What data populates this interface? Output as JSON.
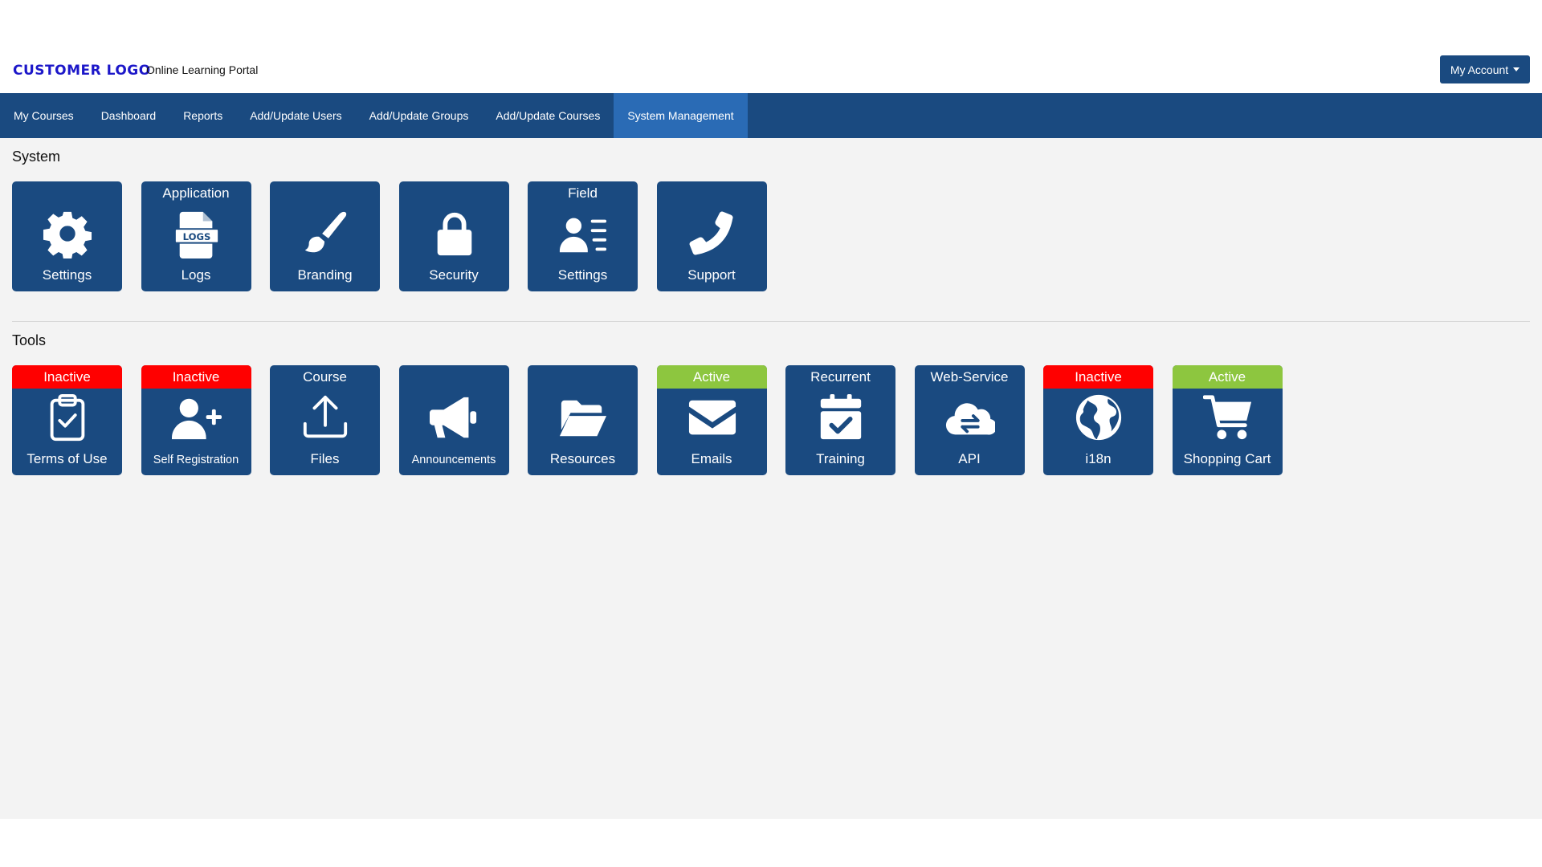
{
  "header": {
    "logo_text": "CUSTOMER LOGO",
    "portal_name": "Online Learning Portal",
    "account_button": "My Account"
  },
  "nav": {
    "items": [
      {
        "label": "My Courses"
      },
      {
        "label": "Dashboard"
      },
      {
        "label": "Reports"
      },
      {
        "label": "Add/Update Users"
      },
      {
        "label": "Add/Update Groups"
      },
      {
        "label": "Add/Update Courses"
      },
      {
        "label": "System Management",
        "active": true
      }
    ]
  },
  "sections": {
    "system": {
      "title": "System",
      "tiles": [
        {
          "top": "",
          "bottom": "Settings",
          "icon": "gear-icon"
        },
        {
          "top": "Application",
          "bottom": "Logs",
          "icon": "logs-file-icon"
        },
        {
          "top": "",
          "bottom": "Branding",
          "icon": "paintbrush-icon"
        },
        {
          "top": "",
          "bottom": "Security",
          "icon": "lock-icon"
        },
        {
          "top": "Field",
          "bottom": "Settings",
          "icon": "user-list-icon"
        },
        {
          "top": "",
          "bottom": "Support",
          "icon": "phone-icon"
        }
      ]
    },
    "tools": {
      "title": "Tools",
      "tiles": [
        {
          "top": "Inactive",
          "status": "inactive",
          "bottom": "Terms of Use",
          "icon": "clipboard-check-icon"
        },
        {
          "top": "Inactive",
          "status": "inactive",
          "bottom": "Self Registration",
          "icon": "user-plus-icon"
        },
        {
          "top": "Course",
          "bottom": "Files",
          "icon": "upload-icon"
        },
        {
          "top": "",
          "bottom": "Announcements",
          "icon": "megaphone-icon"
        },
        {
          "top": "",
          "bottom": "Resources",
          "icon": "folder-open-icon"
        },
        {
          "top": "Active",
          "status": "active",
          "bottom": "Emails",
          "icon": "envelope-icon"
        },
        {
          "top": "Recurrent",
          "bottom": "Training",
          "icon": "calendar-check-icon"
        },
        {
          "top": "Web-Service",
          "bottom": "API",
          "icon": "cloud-exchange-icon"
        },
        {
          "top": "Inactive",
          "status": "inactive",
          "bottom": "i18n",
          "icon": "globe-icon"
        },
        {
          "top": "Active",
          "status": "active",
          "bottom": "Shopping Cart",
          "icon": "shopping-cart-icon"
        }
      ]
    }
  },
  "colors": {
    "brand": "#1a4a80",
    "nav_active": "#2a6bb5",
    "inactive": "#ff0000",
    "active": "#8dc63f",
    "logo": "#1c17c9"
  }
}
